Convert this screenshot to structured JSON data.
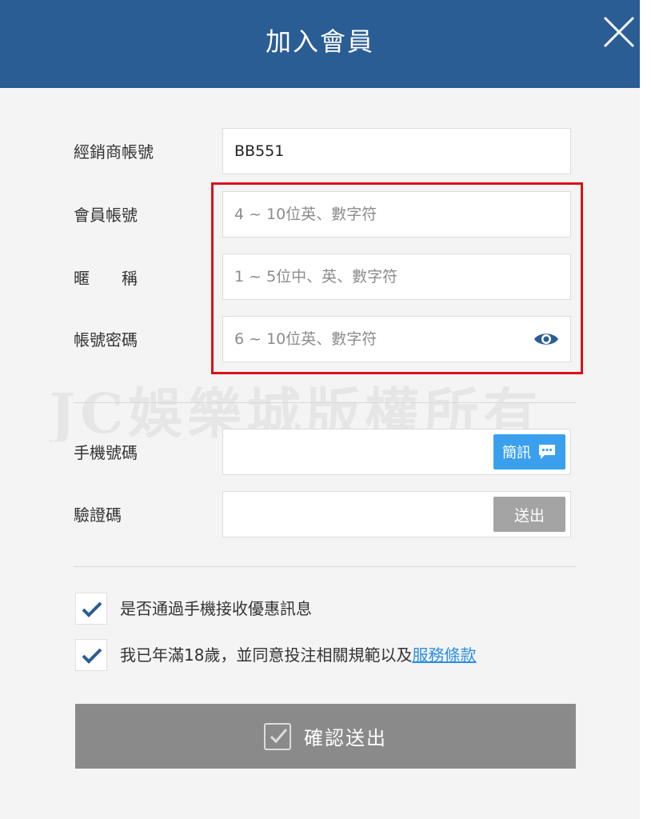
{
  "header": {
    "title": "加入會員"
  },
  "form": {
    "dealer_account": {
      "label": "經銷商帳號",
      "value": "BB551"
    },
    "member_account": {
      "label": "會員帳號",
      "placeholder": "4 ~ 10位英、數字符"
    },
    "nickname": {
      "label": "暱　　稱",
      "placeholder": "1 ~ 5位中、英、數字符"
    },
    "password": {
      "label": "帳號密碼",
      "placeholder": "6 ~ 10位英、數字符"
    },
    "phone": {
      "label": "手機號碼",
      "value": "",
      "sms_button": "簡訊"
    },
    "verify_code": {
      "label": "驗證碼",
      "value": "",
      "send_button": "送出"
    }
  },
  "watermark": "JC娛樂城版權所有",
  "checkboxes": [
    {
      "label": "是否通過手機接收優惠訊息",
      "checked": true
    },
    {
      "label": "我已年滿18歲，並同意投注相關規範以及",
      "link": "服務條款",
      "checked": true
    }
  ],
  "submit": {
    "label": "確認送出"
  },
  "colors": {
    "header": "#2a5d93",
    "highlight": "#d8121a",
    "sms_button": "#3aa0ee",
    "send_button": "#a4a4a4",
    "submit_button": "#8a8a8a",
    "link": "#2b8ee0",
    "check": "#2a5d93"
  },
  "icons": {
    "close": "close-icon",
    "eye": "eye-icon",
    "sms": "chat-bubble-icon",
    "check": "checkmark-icon"
  }
}
